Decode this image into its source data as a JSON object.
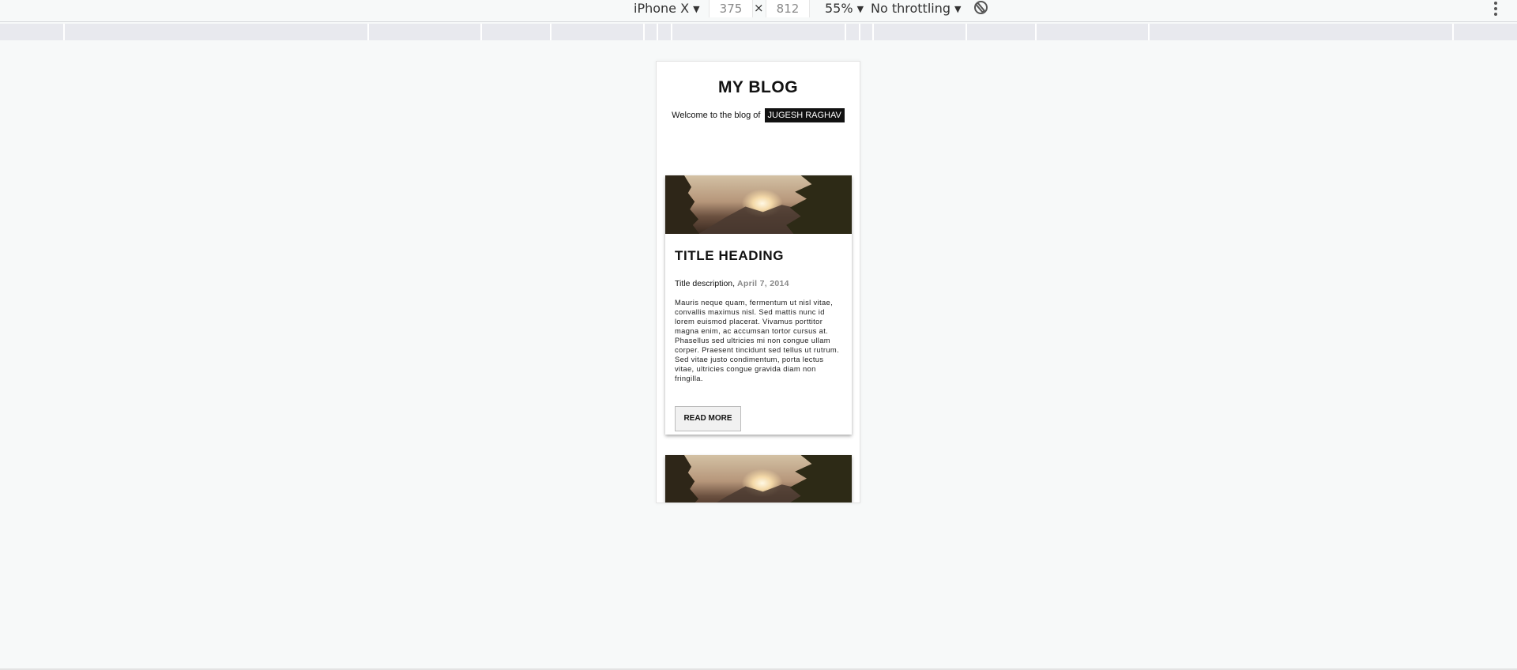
{
  "toolbar": {
    "device": "iPhone X",
    "width": "375",
    "height": "812",
    "times": "×",
    "zoom": "55%",
    "throttling": "No throttling",
    "icons": [
      "chevron-down-icon",
      "rotate-icon",
      "more-vert-icon"
    ]
  },
  "page": {
    "title": "MY BLOG",
    "welcome_text": "Welcome to the blog of",
    "author": "JUGESH RAGHAV"
  },
  "posts": [
    {
      "heading": "TITLE HEADING",
      "description": "Title description,",
      "date": "April 7, 2014",
      "body": "Mauris neque quam, fermentum ut nisl vitae, convallis maximus nisl. Sed mattis nunc id lorem euismod placerat. Vivamus porttitor magna enim, ac accumsan tortor cursus at. Phasellus sed ultricies mi non congue ullam corper. Praesent tincidunt sed tellus ut rutrum. Sed vitae justo condimentum, porta lectus vitae, ultricies congue gravida diam non fringilla.",
      "button": "READ MORE",
      "image": "forest-sunset-image"
    },
    {
      "image": "forest-sunset-image"
    }
  ],
  "colors": {
    "background": "#f7f9f9",
    "author_tag_bg": "#111111",
    "date": "#888888"
  }
}
